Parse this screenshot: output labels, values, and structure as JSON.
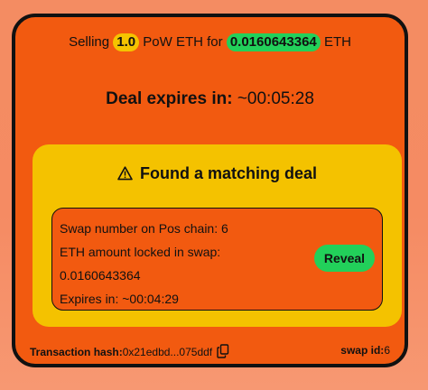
{
  "header": {
    "selling_prefix": "Selling",
    "amount": "1.0",
    "pair_text": "PoW ETH for",
    "eth_amount": "0.0160643364",
    "suffix": "ETH"
  },
  "deal_expiry": {
    "label": "Deal expires in:",
    "value": "~00:05:28"
  },
  "match": {
    "title": "Found a matching deal",
    "icon": "warning-icon",
    "swap_number_label": "Swap number on Pos chain:",
    "swap_number_value": "6",
    "eth_locked_label": "ETH amount locked in swap:",
    "eth_locked_value": "0.0160643364",
    "expires_label": "Expires in:",
    "expires_value": "~00:04:29",
    "reveal_label": "Reveal"
  },
  "footer": {
    "tx_hash_label": "Transaction hash:",
    "tx_hash_value": "0x21edbd...075ddf",
    "copy_icon": "copy-icon",
    "swap_id_label": "swap id:",
    "swap_id_value": "6"
  },
  "colors": {
    "background": "#f48c62",
    "card": "#f25a10",
    "yellow": "#f4c200",
    "green": "#22d05a",
    "border": "#111111"
  }
}
